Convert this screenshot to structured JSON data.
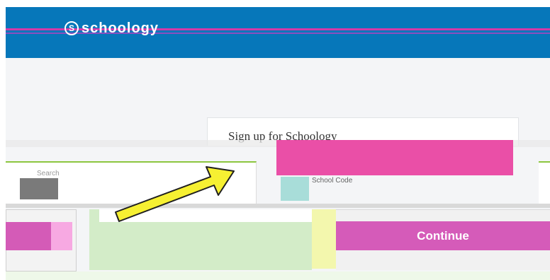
{
  "header": {
    "logo_mark": "S",
    "logo_text": "schoology"
  },
  "signup_card": {
    "title": "Sign up for Schoology"
  },
  "school_search": {
    "hint": "Search"
  },
  "school_field": {
    "label": "School Code"
  },
  "actions": {
    "continue_label": "Continue"
  },
  "annotation": {
    "arrow_color": "#f6f032",
    "arrow_outline": "#1f1f1f"
  },
  "colors": {
    "header_blue": "#0677ba",
    "accent_pink": "#ea4fa7",
    "accent_green": "#8cc63f",
    "button_pink": "#d55bb9"
  }
}
